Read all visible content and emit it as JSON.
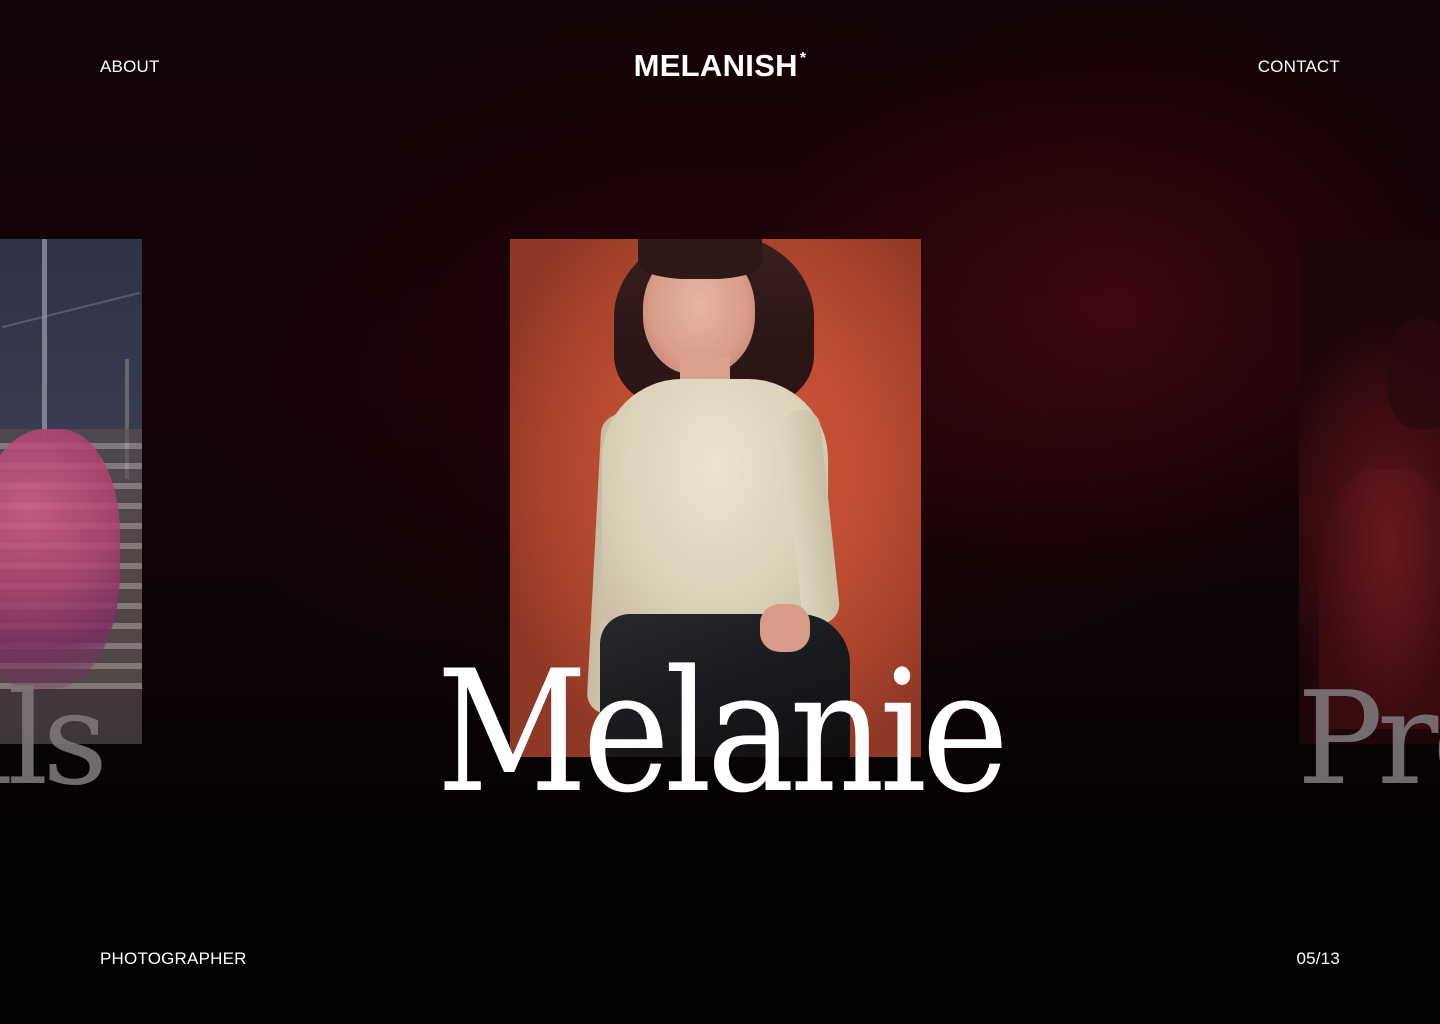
{
  "header": {
    "nav_left": "ABOUT",
    "logo": "MELANISH",
    "logo_mark": "*",
    "nav_right": "CONTACT"
  },
  "slider": {
    "current": {
      "name": "Melanie",
      "photo": "portrait-woman-cream-sweater-orange-backdrop"
    },
    "previous": {
      "name_fragment": "ells",
      "photo": "person-in-pink-jacket-rooftop"
    },
    "next": {
      "name_fragment": "Pro",
      "photo": "person-in-red-dim-light"
    }
  },
  "footer": {
    "role": "PHOTOGRAPHER",
    "counter": "05/13"
  },
  "colors": {
    "background": "#0d0305",
    "text": "#ffffff",
    "muted_text": "#7d7679",
    "photo_backdrop": "#bf4e33"
  }
}
